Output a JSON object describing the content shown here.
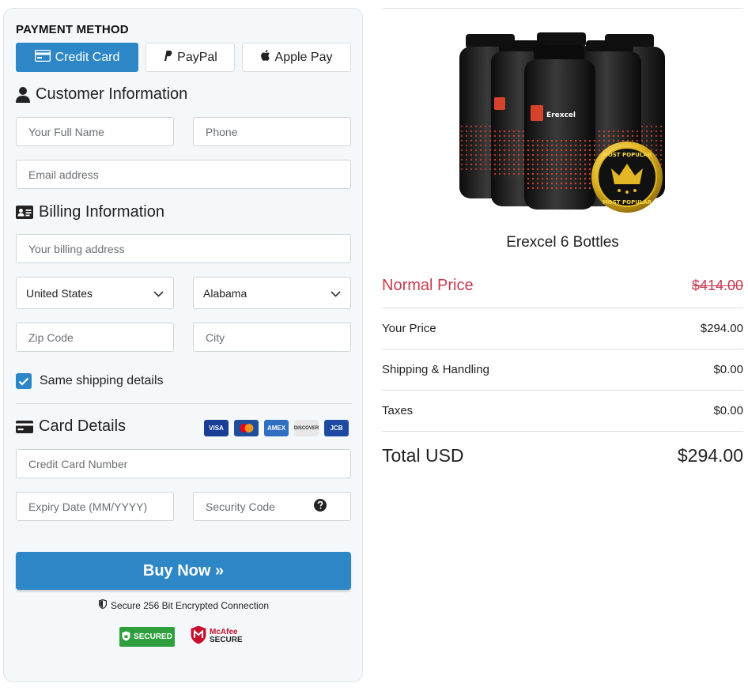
{
  "payment": {
    "title": "PAYMENT METHOD",
    "methods": [
      {
        "label": "Credit Card",
        "icon": "credit-card-icon",
        "active": true
      },
      {
        "label": "PayPal",
        "icon": "paypal-icon",
        "active": false
      },
      {
        "label": "Apple Pay",
        "icon": "apple-icon",
        "active": false
      }
    ]
  },
  "customer": {
    "heading": "Customer Information",
    "full_name_placeholder": "Your Full Name",
    "phone_placeholder": "Phone",
    "email_placeholder": "Email address"
  },
  "billing": {
    "heading": "Billing Information",
    "address_placeholder": "Your billing address",
    "country": "United States",
    "state": "Alabama",
    "zip_placeholder": "Zip Code",
    "city_placeholder": "City",
    "same_shipping_label": "Same shipping details",
    "same_shipping_checked": true
  },
  "card": {
    "heading": "Card Details",
    "logos": [
      "VISA",
      "mastercard",
      "AMEX",
      "DISCOVER",
      "JCB"
    ],
    "number_placeholder": "Credit Card Number",
    "expiry_placeholder": "Expiry Date (MM/YYYY)",
    "security_placeholder": "Security Code"
  },
  "buy": {
    "label": "Buy Now »",
    "secure_text": "Secure 256 Bit Encrypted Connection",
    "badge_secured": "SECURED",
    "badge_mcafee_line1": "McAfee",
    "badge_mcafee_line2": "SECURE"
  },
  "product": {
    "name": "Erexcel 6 Bottles",
    "bottle_brand": "Erexcel",
    "seal_top": "MOST POPULAR",
    "seal_bottom": "MOST POPULAR"
  },
  "pricing": {
    "normal_label": "Normal Price",
    "normal_value": "$414.00",
    "your_label": "Your Price",
    "your_value": "$294.00",
    "shipping_label": "Shipping & Handling",
    "shipping_value": "$0.00",
    "taxes_label": "Taxes",
    "taxes_value": "$0.00",
    "total_label": "Total USD",
    "total_value": "$294.00"
  },
  "colors": {
    "accent": "#2d86c5",
    "normal_price": "#c83a4f",
    "secured_green": "#2f9e3c",
    "mcafee_red": "#c8102e"
  }
}
